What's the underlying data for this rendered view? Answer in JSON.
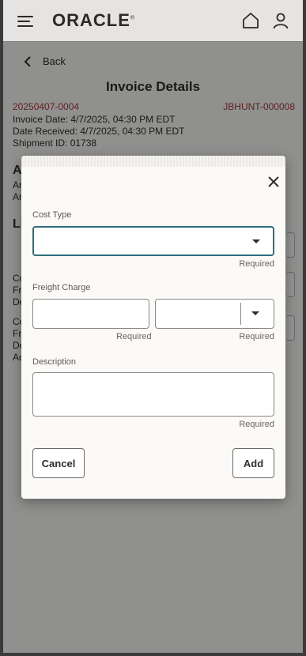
{
  "header": {
    "logo": "ORACLE",
    "logo_mark": "®"
  },
  "nav": {
    "back_label": "Back"
  },
  "page": {
    "title": "Invoice Details",
    "invoice_id": "20250407-0004",
    "carrier_id": "JBHUNT-000008",
    "invoice_date": "Invoice Date: 4/7/2025, 04:30 PM EDT",
    "date_received": "Date Received: 4/7/2025, 04:30 PM EDT",
    "shipment_id": "Shipment ID: 01738"
  },
  "background": {
    "section_a_head": "A",
    "section_a_line1": "Ar",
    "section_a_line2": "Ar",
    "section_l_head": "Li",
    "item1_line1": "Co",
    "item1_line2": "Fr",
    "item1_line3": "De",
    "item2_line1": "Co",
    "item2_line2": "Fr",
    "item2_line3": "De",
    "item2_line4": "Ac"
  },
  "dialog": {
    "cost_type_label": "Cost Type",
    "cost_type_value": "",
    "cost_type_required": "Required",
    "freight_label": "Freight Charge",
    "amount_value": "",
    "amount_required": "Required",
    "currency_value": "",
    "currency_required": "Required",
    "description_label": "Description",
    "description_value": "",
    "description_required": "Required",
    "cancel_label": "Cancel",
    "add_label": "Add"
  },
  "colors": {
    "accent": "#2f6f7f",
    "link_red": "#a0393a",
    "text": "#312d2a"
  }
}
